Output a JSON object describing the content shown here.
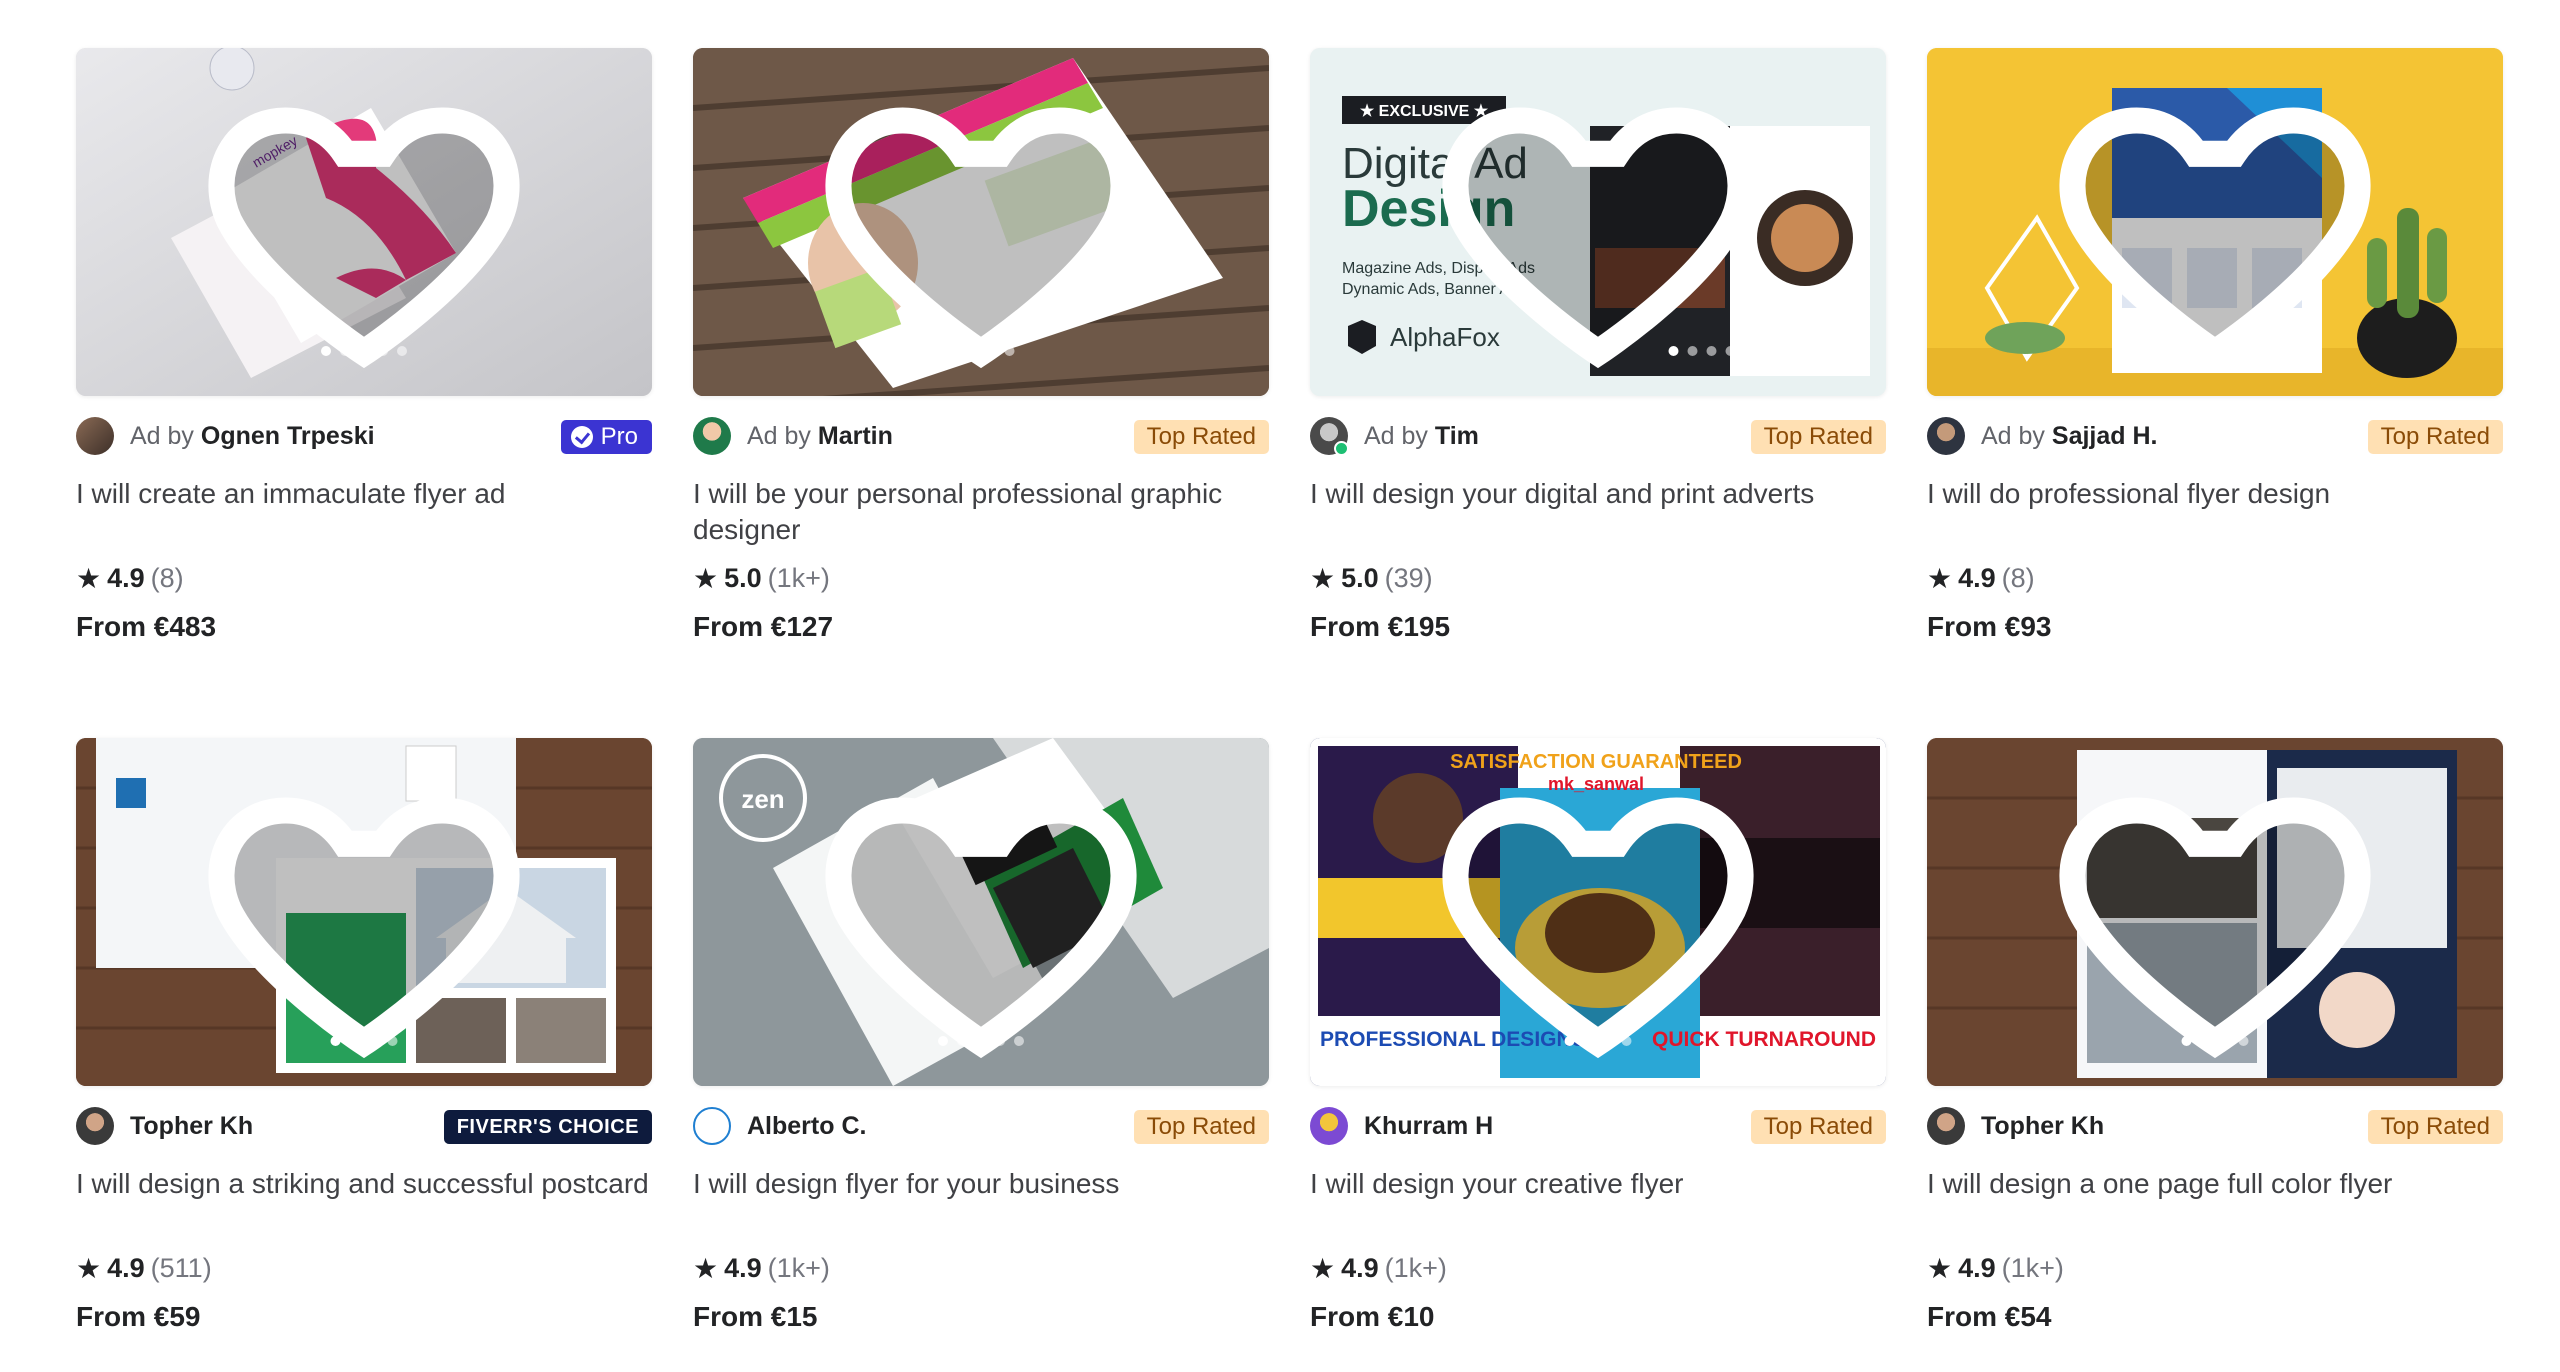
{
  "labels": {
    "ad_by": "Ad by",
    "from": "From",
    "star": "★"
  },
  "gigs": [
    {
      "seller": "Ognen Trpeski",
      "sponsored": true,
      "badge": "Pro",
      "badge_type": "pro",
      "title": "I will create an immaculate flyer ad",
      "rating": "4.9",
      "reviews": "(8)",
      "price": "From €483",
      "theme": "#d9d9dc",
      "dots": 5,
      "active_dot": 0
    },
    {
      "seller": "Martin",
      "sponsored": true,
      "badge": "Top Rated",
      "badge_type": "top",
      "title": "I will be your personal professional graphic designer",
      "rating": "5.0",
      "reviews": "(1k+)",
      "price": "From €127",
      "theme": "#6b5645",
      "dots": 4,
      "active_dot": 0
    },
    {
      "seller": "Tim",
      "sponsored": true,
      "badge": "Top Rated",
      "badge_type": "top",
      "title": "I will design your digital and print adverts",
      "rating": "5.0",
      "reviews": "(39)",
      "price": "From €195",
      "theme": "#e8f1f1",
      "dots": 4,
      "active_dot": 0,
      "image_text": {
        "tag": "★ EXCLUSIVE ★",
        "headline_1": "Digital Ad",
        "headline_2": "Design",
        "sub_1": "Magazine Ads, Display Ads",
        "sub_2": "Dynamic Ads, Banner Ads",
        "brand": "AlphaFox"
      }
    },
    {
      "seller": "Sajjad H.",
      "sponsored": true,
      "badge": "Top Rated",
      "badge_type": "top",
      "title": "I will do professional flyer design",
      "rating": "4.9",
      "reviews": "(8)",
      "price": "From €93",
      "theme": "#f2c230",
      "dots": 5,
      "active_dot": 0
    },
    {
      "seller": "Topher Kh",
      "sponsored": false,
      "badge": "FIVERR'S CHOICE",
      "badge_type": "choice",
      "title": "I will design a striking and successful postcard",
      "rating": "4.9",
      "reviews": "(511)",
      "price": "From €59",
      "theme": "#6b4630",
      "dots": 4,
      "active_dot": 0
    },
    {
      "seller": "Alberto C.",
      "sponsored": false,
      "badge": "Top Rated",
      "badge_type": "top",
      "title": "I will design flyer for your business",
      "rating": "4.9",
      "reviews": "(1k+)",
      "price": "From €15",
      "theme": "#9aa3a6",
      "dots": 5,
      "active_dot": 0
    },
    {
      "seller": "Khurram H",
      "sponsored": false,
      "badge": "Top Rated",
      "badge_type": "top",
      "title": "I will design your creative flyer",
      "rating": "4.9",
      "reviews": "(1k+)",
      "price": "From €10",
      "theme": "#1b2a6b",
      "dots": 4,
      "active_dot": 0,
      "image_text": {
        "left_label": "PROFESSIONAL DESIGNS",
        "right_label": "QUICK TURNAROUND",
        "top_label": "SATISFACTION GUARANTEED",
        "handle": "mk_sanwal"
      }
    },
    {
      "seller": "Topher Kh",
      "sponsored": false,
      "badge": "Top Rated",
      "badge_type": "top",
      "title": "I will design a one page full color flyer",
      "rating": "4.9",
      "reviews": "(1k+)",
      "price": "From €54",
      "theme": "#6b4630",
      "dots": 4,
      "active_dot": 0
    }
  ]
}
